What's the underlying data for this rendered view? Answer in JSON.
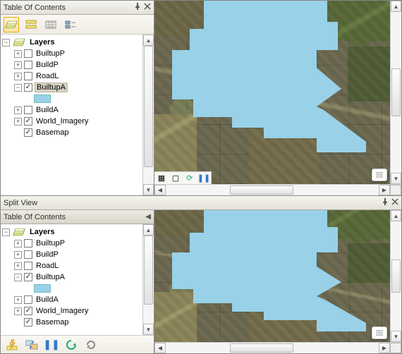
{
  "top": {
    "toc_title": "Table Of Contents",
    "layers_label": "Layers"
  },
  "bottom": {
    "split_title": "Split View",
    "toc_title": "Table Of Contents",
    "layers_label": "Layers"
  },
  "layer_items": [
    {
      "name": "BuiltupP",
      "checked": false,
      "expandable": true,
      "expanded": false,
      "selected": false
    },
    {
      "name": "BuildP",
      "checked": false,
      "expandable": true,
      "expanded": false,
      "selected": false
    },
    {
      "name": "RoadL",
      "checked": false,
      "expandable": true,
      "expanded": false,
      "selected": false
    },
    {
      "name": "BuiltupA",
      "checked": true,
      "expandable": true,
      "expanded": true,
      "selected": true,
      "swatch": "#99d1e8"
    },
    {
      "name": "BuildA",
      "checked": false,
      "expandable": true,
      "expanded": false,
      "selected": false
    },
    {
      "name": "World_Imagery",
      "checked": true,
      "expandable": true,
      "expanded": false,
      "selected": false
    },
    {
      "name": "Basemap",
      "checked": true,
      "expandable": false,
      "expanded": false,
      "selected": false
    }
  ],
  "bottom_layer_items": [
    {
      "name": "BuiltupP",
      "checked": false,
      "expandable": true,
      "expanded": false,
      "selected": false
    },
    {
      "name": "BuildP",
      "checked": false,
      "expandable": true,
      "expanded": false,
      "selected": false
    },
    {
      "name": "RoadL",
      "checked": false,
      "expandable": true,
      "expanded": false,
      "selected": false
    },
    {
      "name": "BuiltupA",
      "checked": true,
      "expandable": true,
      "expanded": true,
      "selected": false,
      "swatch": "#99d1e8"
    },
    {
      "name": "BuildA",
      "checked": false,
      "expandable": true,
      "expanded": false,
      "selected": false
    },
    {
      "name": "World_Imagery",
      "checked": true,
      "expandable": true,
      "expanded": false,
      "selected": false
    },
    {
      "name": "Basemap",
      "checked": true,
      "expandable": false,
      "expanded": false,
      "selected": false
    }
  ],
  "colors": {
    "builtup_fill": "#99d1e8"
  }
}
